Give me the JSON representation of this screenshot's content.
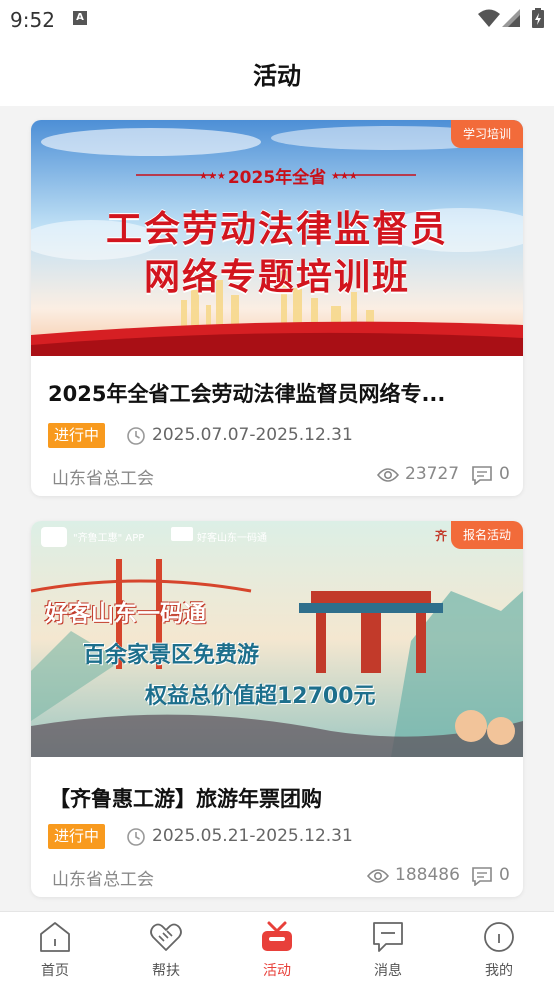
{
  "status_bar": {
    "time": "9:52",
    "notification_icon": "A"
  },
  "header": {
    "title": "活动"
  },
  "activities": [
    {
      "tag": "学习培训",
      "banner": {
        "line1": "2025年全省",
        "line2": "工会劳动法律监督员",
        "line3": "网络专题培训班"
      },
      "title": "2025年全省工会劳动法律监督员网络专...",
      "status": "进行中",
      "dates": "2025.07.07-2025.12.31",
      "organizer": "山东省总工会",
      "views": "23727",
      "comments": "0"
    },
    {
      "tag": "报名活动",
      "banner": {
        "top_left": "\"齐鲁工惠\" APP",
        "top_mid": "好客山东一码通",
        "top_right": "齐",
        "line1": "好客山东一码通",
        "line2": "百余家景区免费游",
        "line3": "权益总价值超12700元"
      },
      "title": "【齐鲁惠工游】旅游年票团购",
      "status": "进行中",
      "dates": "2025.05.21-2025.12.31",
      "organizer": "山东省总工会",
      "views": "188486",
      "comments": "0"
    }
  ],
  "bottom_nav": [
    {
      "label": "首页",
      "icon": "home-icon"
    },
    {
      "label": "帮扶",
      "icon": "handshake-icon"
    },
    {
      "label": "活动",
      "icon": "gift-icon",
      "active": true
    },
    {
      "label": "消息",
      "icon": "message-icon"
    },
    {
      "label": "我的",
      "icon": "profile-icon"
    }
  ],
  "colors": {
    "accent": "#e8403a",
    "tag": "#f26b3a",
    "status_pill": "#f89a1e"
  }
}
